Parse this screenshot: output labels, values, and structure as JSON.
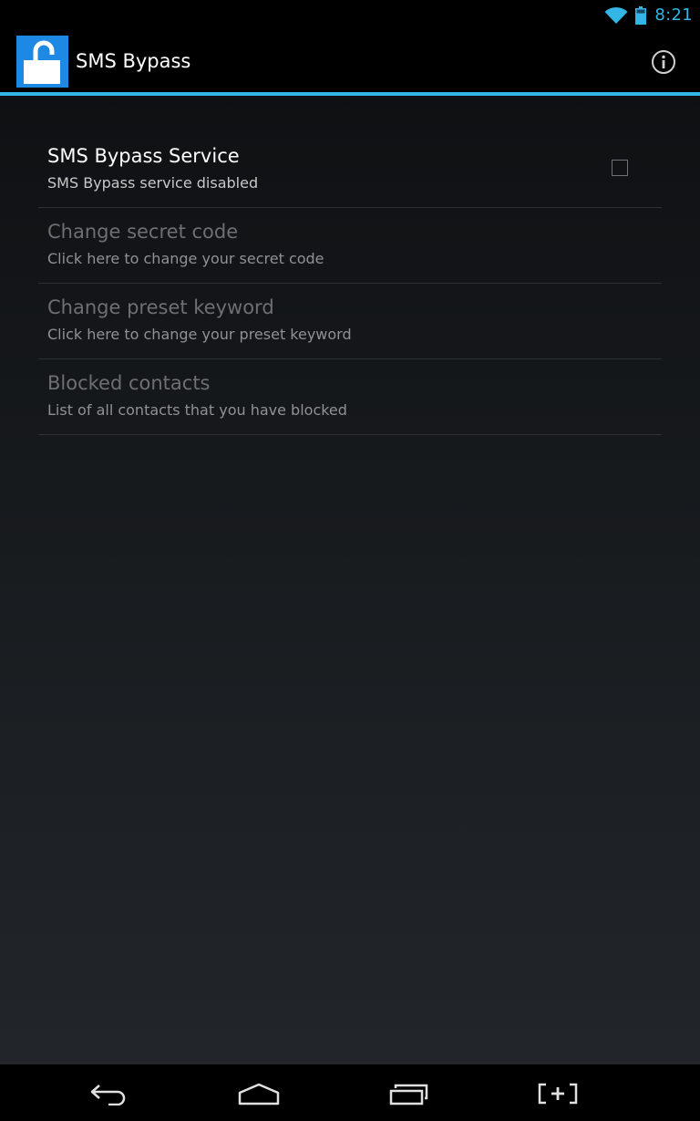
{
  "status_bar": {
    "time": "8:21",
    "icons": [
      "wifi-icon",
      "battery-icon"
    ]
  },
  "action_bar": {
    "app_icon": "padlock-open-icon",
    "title": "SMS Bypass",
    "info_icon": "info-icon"
  },
  "preferences": [
    {
      "title": "SMS Bypass Service",
      "summary": "SMS Bypass service disabled",
      "enabled": true,
      "checkbox_checked": false
    },
    {
      "title": "Change secret code",
      "summary": "Click here to change your secret code",
      "enabled": false
    },
    {
      "title": "Change preset keyword",
      "summary": "Click here to change your preset keyword",
      "enabled": false
    },
    {
      "title": "Blocked contacts",
      "summary": "List of all contacts that you have blocked",
      "enabled": false
    }
  ],
  "nav_bar": {
    "buttons": [
      "back-icon",
      "home-icon",
      "recent-apps-icon",
      "screenshot-icon"
    ]
  },
  "colors": {
    "accent": "#33b5e5",
    "app_icon_bg": "#1e88e5"
  }
}
